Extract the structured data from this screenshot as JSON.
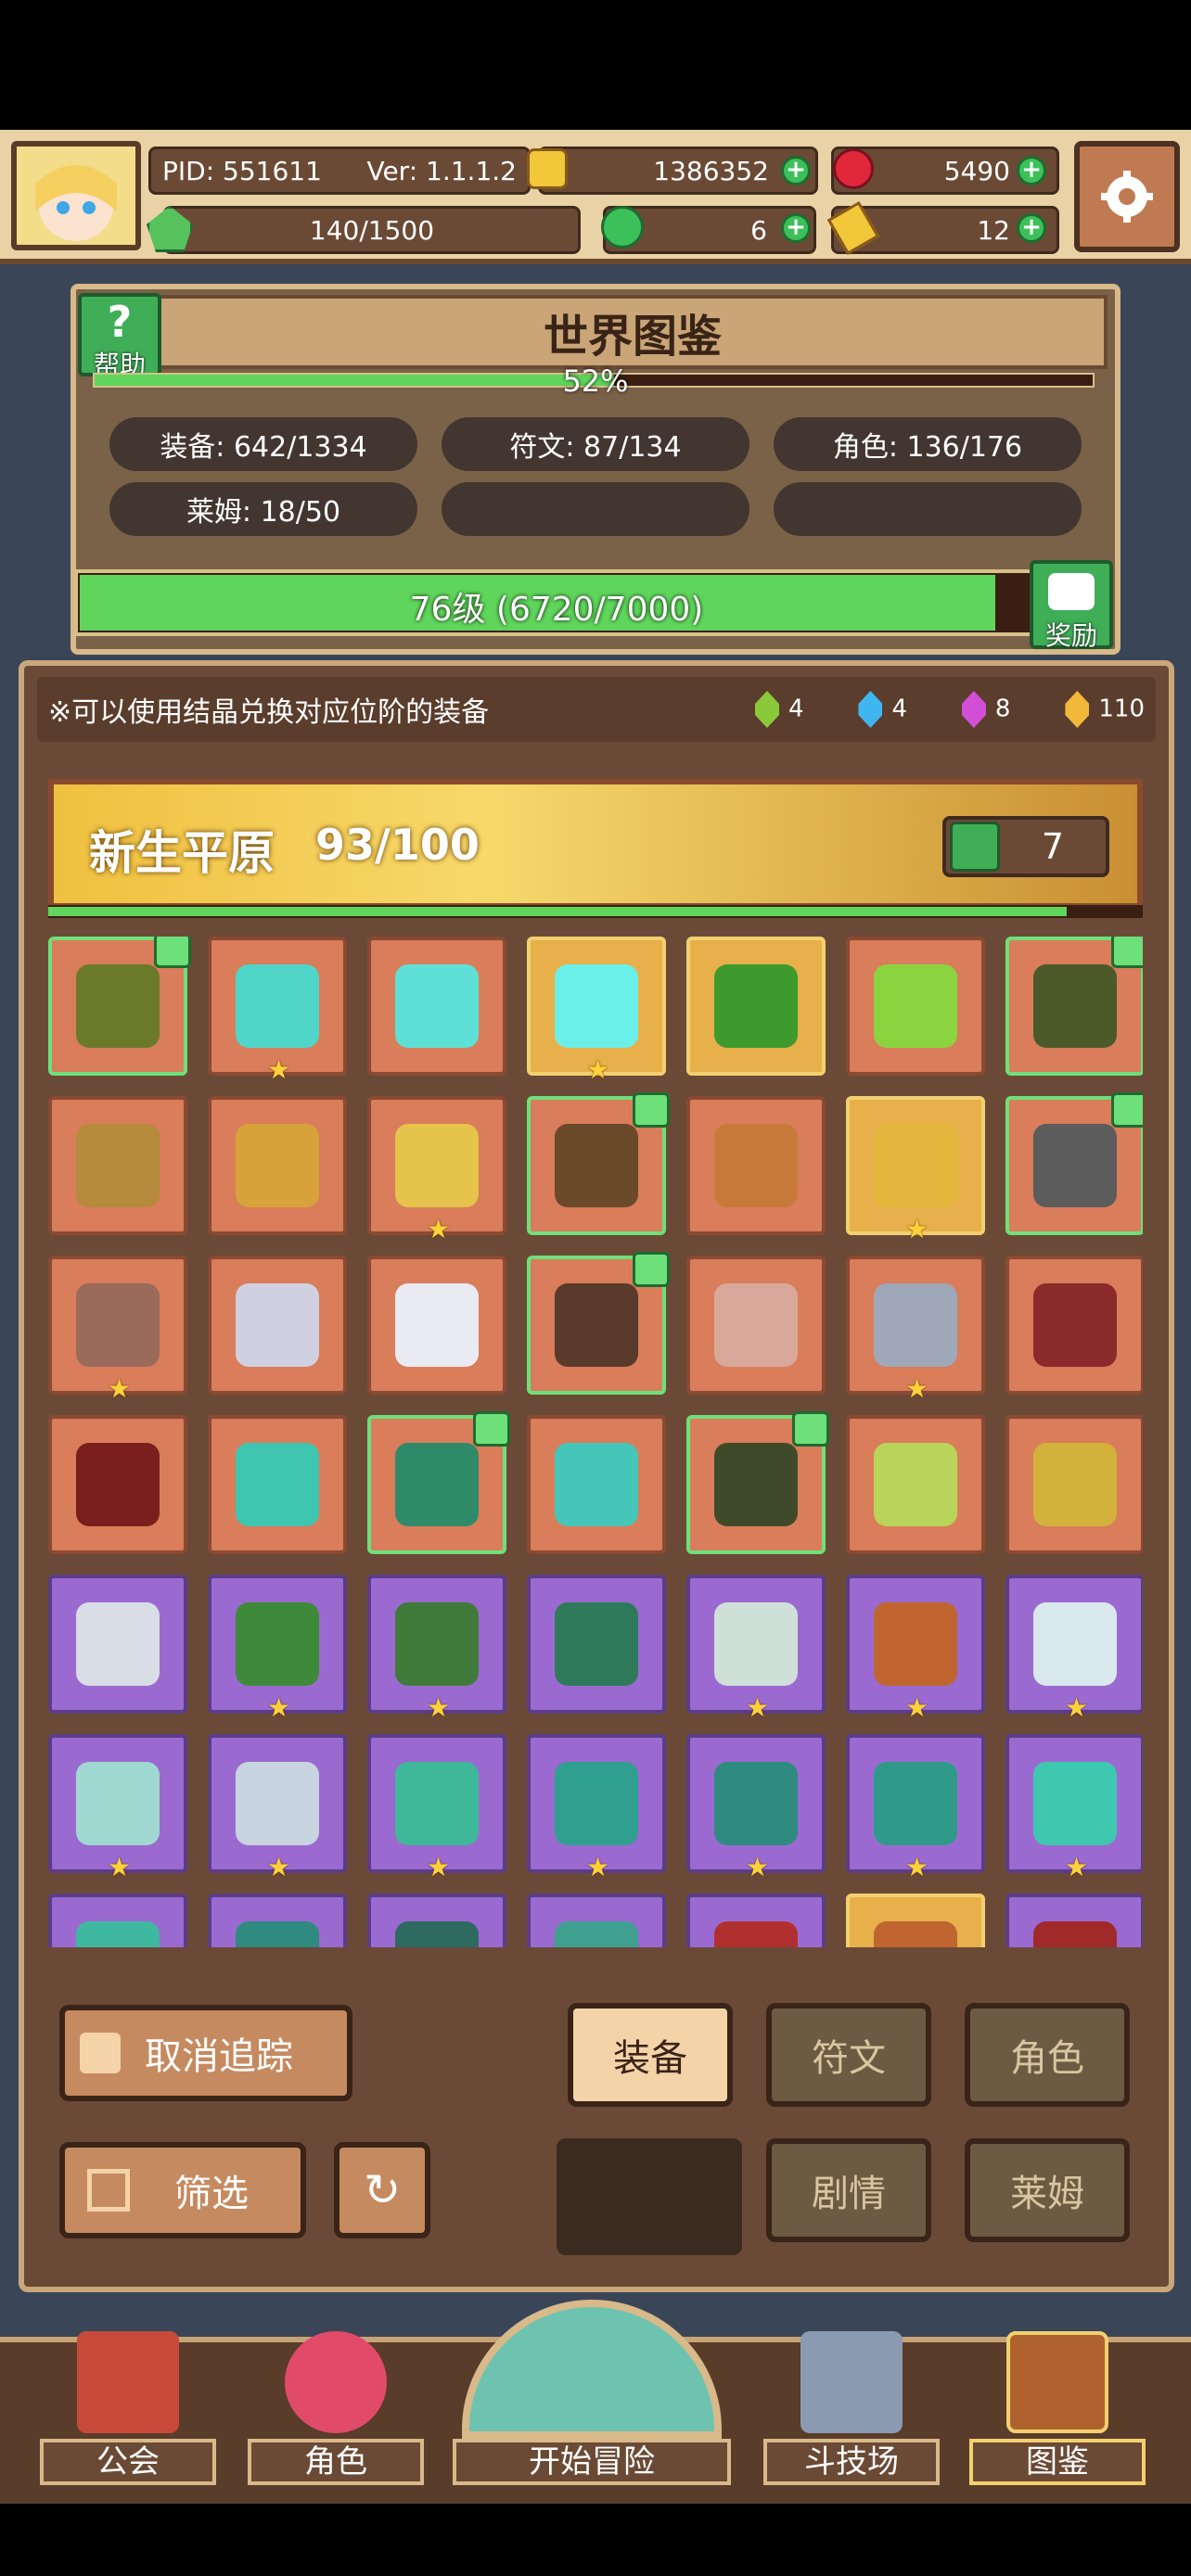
{
  "header": {
    "pid": "PID: 551611",
    "version": "Ver: 1.1.1.2",
    "gold": "1386352",
    "ruby": "5490",
    "stamina": "140/1500",
    "clover": "6",
    "key": "12"
  },
  "world": {
    "title": "世界图鉴",
    "progress": "52%",
    "stats": {
      "equip": "装备: 642/1334",
      "rune": "符文: 87/134",
      "role": "角色: 136/176",
      "slime": "莱姆: 18/50"
    },
    "help_label": "帮助",
    "level": "76级 (6720/7000)",
    "level_progress": 0.96,
    "reward_label": "奖励"
  },
  "notice": {
    "text": "※可以使用结晶兑换对应位阶的装备",
    "crystals": [
      {
        "count": "4",
        "color": "#8ac93a"
      },
      {
        "count": "4",
        "color": "#3fb6f0"
      },
      {
        "count": "8",
        "color": "#d14fd6"
      },
      {
        "count": "110",
        "color": "#f1b83a"
      }
    ]
  },
  "region": {
    "name": "新生平原",
    "count": "93/100",
    "likes": "7"
  },
  "grid": {
    "rows": [
      [
        {
          "rarity": "orange",
          "tracked": true,
          "star": false,
          "color": "#6b7a2a",
          "icon": "hat-icon"
        },
        {
          "rarity": "orange",
          "tracked": false,
          "star": true,
          "color": "#4fd6c9",
          "icon": "staff-icon"
        },
        {
          "rarity": "orange",
          "tracked": false,
          "star": false,
          "color": "#5fe0d6",
          "icon": "orb-icon"
        },
        {
          "rarity": "gold",
          "tracked": false,
          "star": true,
          "color": "#6af0e8",
          "icon": "crystal-icon"
        },
        {
          "rarity": "gold",
          "tracked": false,
          "star": false,
          "color": "#3e9a2c",
          "icon": "helmet-icon"
        },
        {
          "rarity": "orange",
          "tracked": false,
          "star": false,
          "color": "#8ad43f",
          "icon": "armor-icon"
        },
        {
          "rarity": "orange",
          "tracked": true,
          "star": false,
          "color": "#4c5a2a",
          "icon": "ring-icon"
        }
      ],
      [
        {
          "rarity": "orange",
          "tracked": false,
          "star": false,
          "color": "#b58a3a",
          "icon": "crossbow-icon"
        },
        {
          "rarity": "orange",
          "tracked": false,
          "star": false,
          "color": "#d8a23a",
          "icon": "arrow-icon"
        },
        {
          "rarity": "orange",
          "tracked": false,
          "star": true,
          "color": "#e6c34a",
          "icon": "necklace-icon"
        },
        {
          "rarity": "orange",
          "tracked": true,
          "star": false,
          "color": "#6b4a2a",
          "icon": "hammer-icon"
        },
        {
          "rarity": "orange",
          "tracked": false,
          "star": false,
          "color": "#c87a3a",
          "icon": "ring-icon"
        },
        {
          "rarity": "gold",
          "tracked": false,
          "star": true,
          "color": "#e3b53a",
          "icon": "ring-gem-icon"
        },
        {
          "rarity": "orange",
          "tracked": true,
          "star": false,
          "color": "#5c5c5c",
          "icon": "axe-icon"
        }
      ],
      [
        {
          "rarity": "orange",
          "tracked": false,
          "star": true,
          "color": "#9a6a5a",
          "icon": "ring-icon"
        },
        {
          "rarity": "orange",
          "tracked": false,
          "star": false,
          "color": "#d0d0e0",
          "icon": "ring-gem-icon"
        },
        {
          "rarity": "orange",
          "tracked": false,
          "star": false,
          "color": "#eaeaf2",
          "icon": "orb-icon"
        },
        {
          "rarity": "orange",
          "tracked": true,
          "star": false,
          "color": "#5a3a2a",
          "icon": "gauntlet-icon"
        },
        {
          "rarity": "orange",
          "tracked": false,
          "star": false,
          "color": "#d9a89a",
          "icon": "necklace-icon"
        },
        {
          "rarity": "orange",
          "tracked": false,
          "star": true,
          "color": "#9fa8b8",
          "icon": "sword-icon"
        },
        {
          "rarity": "orange",
          "tracked": false,
          "star": false,
          "color": "#8a2a2a",
          "icon": "hood-icon"
        }
      ],
      [
        {
          "rarity": "orange",
          "tracked": false,
          "star": false,
          "color": "#7a1e1e",
          "icon": "robe-icon"
        },
        {
          "rarity": "orange",
          "tracked": false,
          "star": false,
          "color": "#3ec6b0",
          "icon": "bow-icon"
        },
        {
          "rarity": "orange",
          "tracked": true,
          "star": false,
          "color": "#2f8a6a",
          "icon": "spear-icon"
        },
        {
          "rarity": "orange",
          "tracked": false,
          "star": false,
          "color": "#45c6b8",
          "icon": "boots-icon"
        },
        {
          "rarity": "orange",
          "tracked": true,
          "star": false,
          "color": "#3f4a2a",
          "icon": "hood-icon"
        },
        {
          "rarity": "orange",
          "tracked": false,
          "star": false,
          "color": "#b9d45a",
          "icon": "glove-icon"
        },
        {
          "rarity": "orange",
          "tracked": false,
          "star": false,
          "color": "#d2b23a",
          "icon": "crown-icon"
        }
      ],
      [
        {
          "rarity": "purple",
          "tracked": false,
          "star": false,
          "color": "#d8dde6",
          "icon": "sword-icon"
        },
        {
          "rarity": "purple",
          "tracked": false,
          "star": true,
          "color": "#3e8a3a",
          "icon": "helmet-icon"
        },
        {
          "rarity": "purple",
          "tracked": false,
          "star": true,
          "color": "#3f7a3a",
          "icon": "armor-icon"
        },
        {
          "rarity": "purple",
          "tracked": false,
          "star": false,
          "color": "#2f7a5a",
          "icon": "bow-icon"
        },
        {
          "rarity": "purple",
          "tracked": false,
          "star": true,
          "color": "#cfe0d8",
          "icon": "spear-icon"
        },
        {
          "rarity": "purple",
          "tracked": false,
          "star": true,
          "color": "#c0652f",
          "icon": "boots-icon"
        },
        {
          "rarity": "purple",
          "tracked": false,
          "star": true,
          "color": "#d8e8ec",
          "icon": "armor-icon"
        }
      ],
      [
        {
          "rarity": "purple",
          "tracked": false,
          "star": true,
          "color": "#9fd8d0",
          "icon": "ring-icon"
        },
        {
          "rarity": "purple",
          "tracked": false,
          "star": true,
          "color": "#c8d4e0",
          "icon": "boots-icon"
        },
        {
          "rarity": "purple",
          "tracked": false,
          "star": true,
          "color": "#3fb89a",
          "icon": "staff-icon"
        },
        {
          "rarity": "purple",
          "tracked": false,
          "star": true,
          "color": "#2fa090",
          "icon": "hat-icon"
        },
        {
          "rarity": "purple",
          "tracked": false,
          "star": true,
          "color": "#2f8a80",
          "icon": "armor-icon"
        },
        {
          "rarity": "purple",
          "tracked": false,
          "star": true,
          "color": "#2f9a8a",
          "icon": "gauntlet-icon"
        },
        {
          "rarity": "purple",
          "tracked": false,
          "star": true,
          "color": "#3fc8b0",
          "icon": "necklace-icon"
        }
      ],
      [
        {
          "rarity": "purple",
          "tracked": false,
          "star": false,
          "color": "#3fb8a0",
          "icon": "gem-icon"
        },
        {
          "rarity": "purple",
          "tracked": false,
          "star": false,
          "color": "#2f8a80",
          "icon": "helmet-icon"
        },
        {
          "rarity": "purple",
          "tracked": false,
          "star": false,
          "color": "#2f6a60",
          "icon": "ring-icon"
        },
        {
          "rarity": "purple",
          "tracked": false,
          "star": false,
          "color": "#3fa090",
          "icon": "hat-icon"
        },
        {
          "rarity": "purple",
          "tracked": false,
          "star": false,
          "color": "#b03030",
          "icon": "hood-icon"
        },
        {
          "rarity": "gold",
          "tracked": false,
          "star": false,
          "color": "#c0652f",
          "icon": "armor-icon"
        },
        {
          "rarity": "purple",
          "tracked": false,
          "star": false,
          "color": "#a02a2a",
          "icon": "gauntlet-icon"
        }
      ]
    ]
  },
  "controls": {
    "untrack": "取消追踪",
    "filter": "筛选",
    "tabs": {
      "equip": "装备",
      "rune": "符文",
      "role": "角色",
      "story": "剧情",
      "slime": "莱姆"
    }
  },
  "nav": {
    "guild": "公会",
    "role": "角色",
    "adventure": "开始冒险",
    "arena": "斗技场",
    "codex": "图鉴"
  }
}
